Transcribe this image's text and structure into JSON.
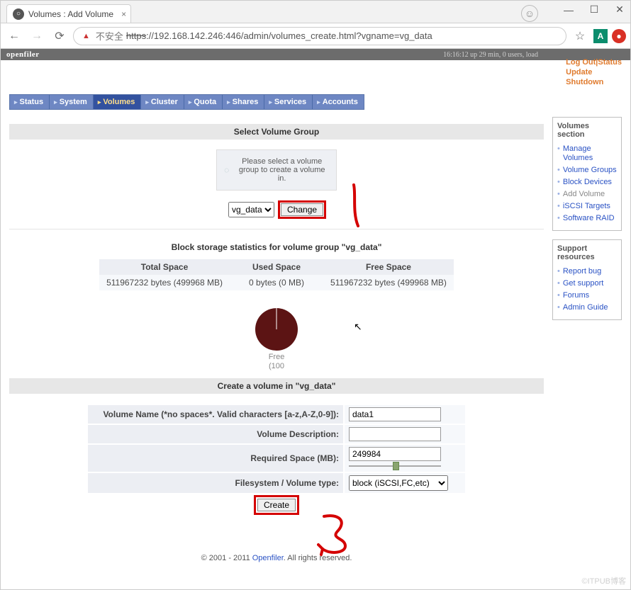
{
  "browser": {
    "tab_title": "Volumes : Add Volume",
    "url_insecure_label": "不安全",
    "url_prefix_strike": "https",
    "url_rest": "://192.168.142.246:446/admin/volumes_create.html?vgname=vg_data"
  },
  "header": {
    "brand": "openfiler",
    "uptime": "16:16:12 up 29 min, 0 users, load",
    "links": {
      "logout": "Log Out",
      "status": "Status",
      "update": "Update",
      "shutdown": "Shutdown"
    }
  },
  "nav": {
    "items": [
      "Status",
      "System",
      "Volumes",
      "Cluster",
      "Quota",
      "Shares",
      "Services",
      "Accounts"
    ],
    "active_index": 2
  },
  "select_vg": {
    "heading": "Select Volume Group",
    "tip": "Please select a volume group to create a volume in.",
    "selected": "vg_data",
    "change_label": "Change"
  },
  "stats": {
    "heading": "Block storage statistics for volume group \"vg_data\"",
    "cols": [
      "Total Space",
      "Used Space",
      "Free Space"
    ],
    "values": [
      "511967232 bytes (499968 MB)",
      "0 bytes (0 MB)",
      "511967232 bytes (499968 MB)"
    ]
  },
  "pie": {
    "label1": "Free",
    "label2": "(100"
  },
  "create": {
    "heading": "Create a volume in \"vg_data\"",
    "rows": {
      "name_label": "Volume Name (*no spaces*. Valid characters [a-z,A-Z,0-9]):",
      "name_value": "data1",
      "desc_label": "Volume Description:",
      "desc_value": "",
      "space_label": "Required Space (MB):",
      "space_value": "249984",
      "fstype_label": "Filesystem / Volume type:",
      "fstype_value": "block (iSCSI,FC,etc)"
    },
    "submit": "Create"
  },
  "sidebar": {
    "volumes_title": "Volumes section",
    "volumes_links": [
      "Manage Volumes",
      "Volume Groups",
      "Block Devices",
      "Add Volume",
      "iSCSI Targets",
      "Software RAID"
    ],
    "support_title": "Support resources",
    "support_links": [
      "Report bug",
      "Get support",
      "Forums",
      "Admin Guide"
    ]
  },
  "footer": {
    "prefix": "© 2001 - 2011 ",
    "link": "Openfiler",
    "suffix": ". All rights reserved."
  },
  "watermark": "©ITPUB博客",
  "chart_data": {
    "type": "pie",
    "title": "",
    "series": [
      {
        "name": "Free",
        "values": [
          100
        ]
      }
    ],
    "categories": [
      "Free"
    ],
    "values": [
      100
    ]
  }
}
